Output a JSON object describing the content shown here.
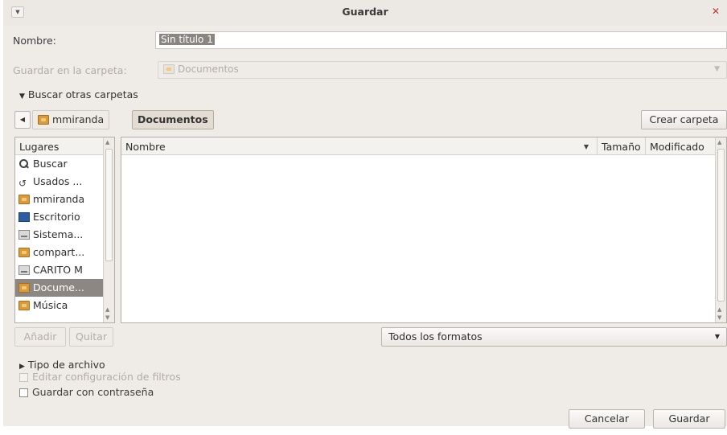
{
  "window": {
    "title": "Guardar"
  },
  "name_row": {
    "label": "Nombre:",
    "value": "Sin título 1"
  },
  "folder_row": {
    "label": "Guardar en la carpeta:",
    "value": "Documentos"
  },
  "browse_expander": {
    "label": "Buscar otras carpetas"
  },
  "path_bar": {
    "items": [
      "mmiranda",
      "Documentos"
    ],
    "create_folder": "Crear carpeta"
  },
  "places": {
    "header": "Lugares",
    "items": [
      {
        "label": "Buscar",
        "icon": "search-icon"
      },
      {
        "label": "Usados ...",
        "icon": "recent-icon"
      },
      {
        "label": "mmiranda",
        "icon": "folder-icon"
      },
      {
        "label": "Escritorio",
        "icon": "desktop-icon"
      },
      {
        "label": "Sistema...",
        "icon": "drive-icon"
      },
      {
        "label": "compart...",
        "icon": "folder-icon"
      },
      {
        "label": "CARITO M",
        "icon": "drive-icon"
      },
      {
        "label": "Docume...",
        "icon": "folder-icon"
      },
      {
        "label": "Música",
        "icon": "folder-icon"
      }
    ],
    "add": "Añadir",
    "remove": "Quitar"
  },
  "files": {
    "columns": {
      "name": "Nombre",
      "size": "Tamaño",
      "modified": "Modificado"
    }
  },
  "filter": {
    "value": "Todos los formatos"
  },
  "file_type_expander": {
    "label": "Tipo de archivo"
  },
  "options": {
    "edit_filter": "Editar configuración de filtros",
    "password": "Guardar con contraseña"
  },
  "actions": {
    "cancel": "Cancelar",
    "save": "Guardar"
  }
}
